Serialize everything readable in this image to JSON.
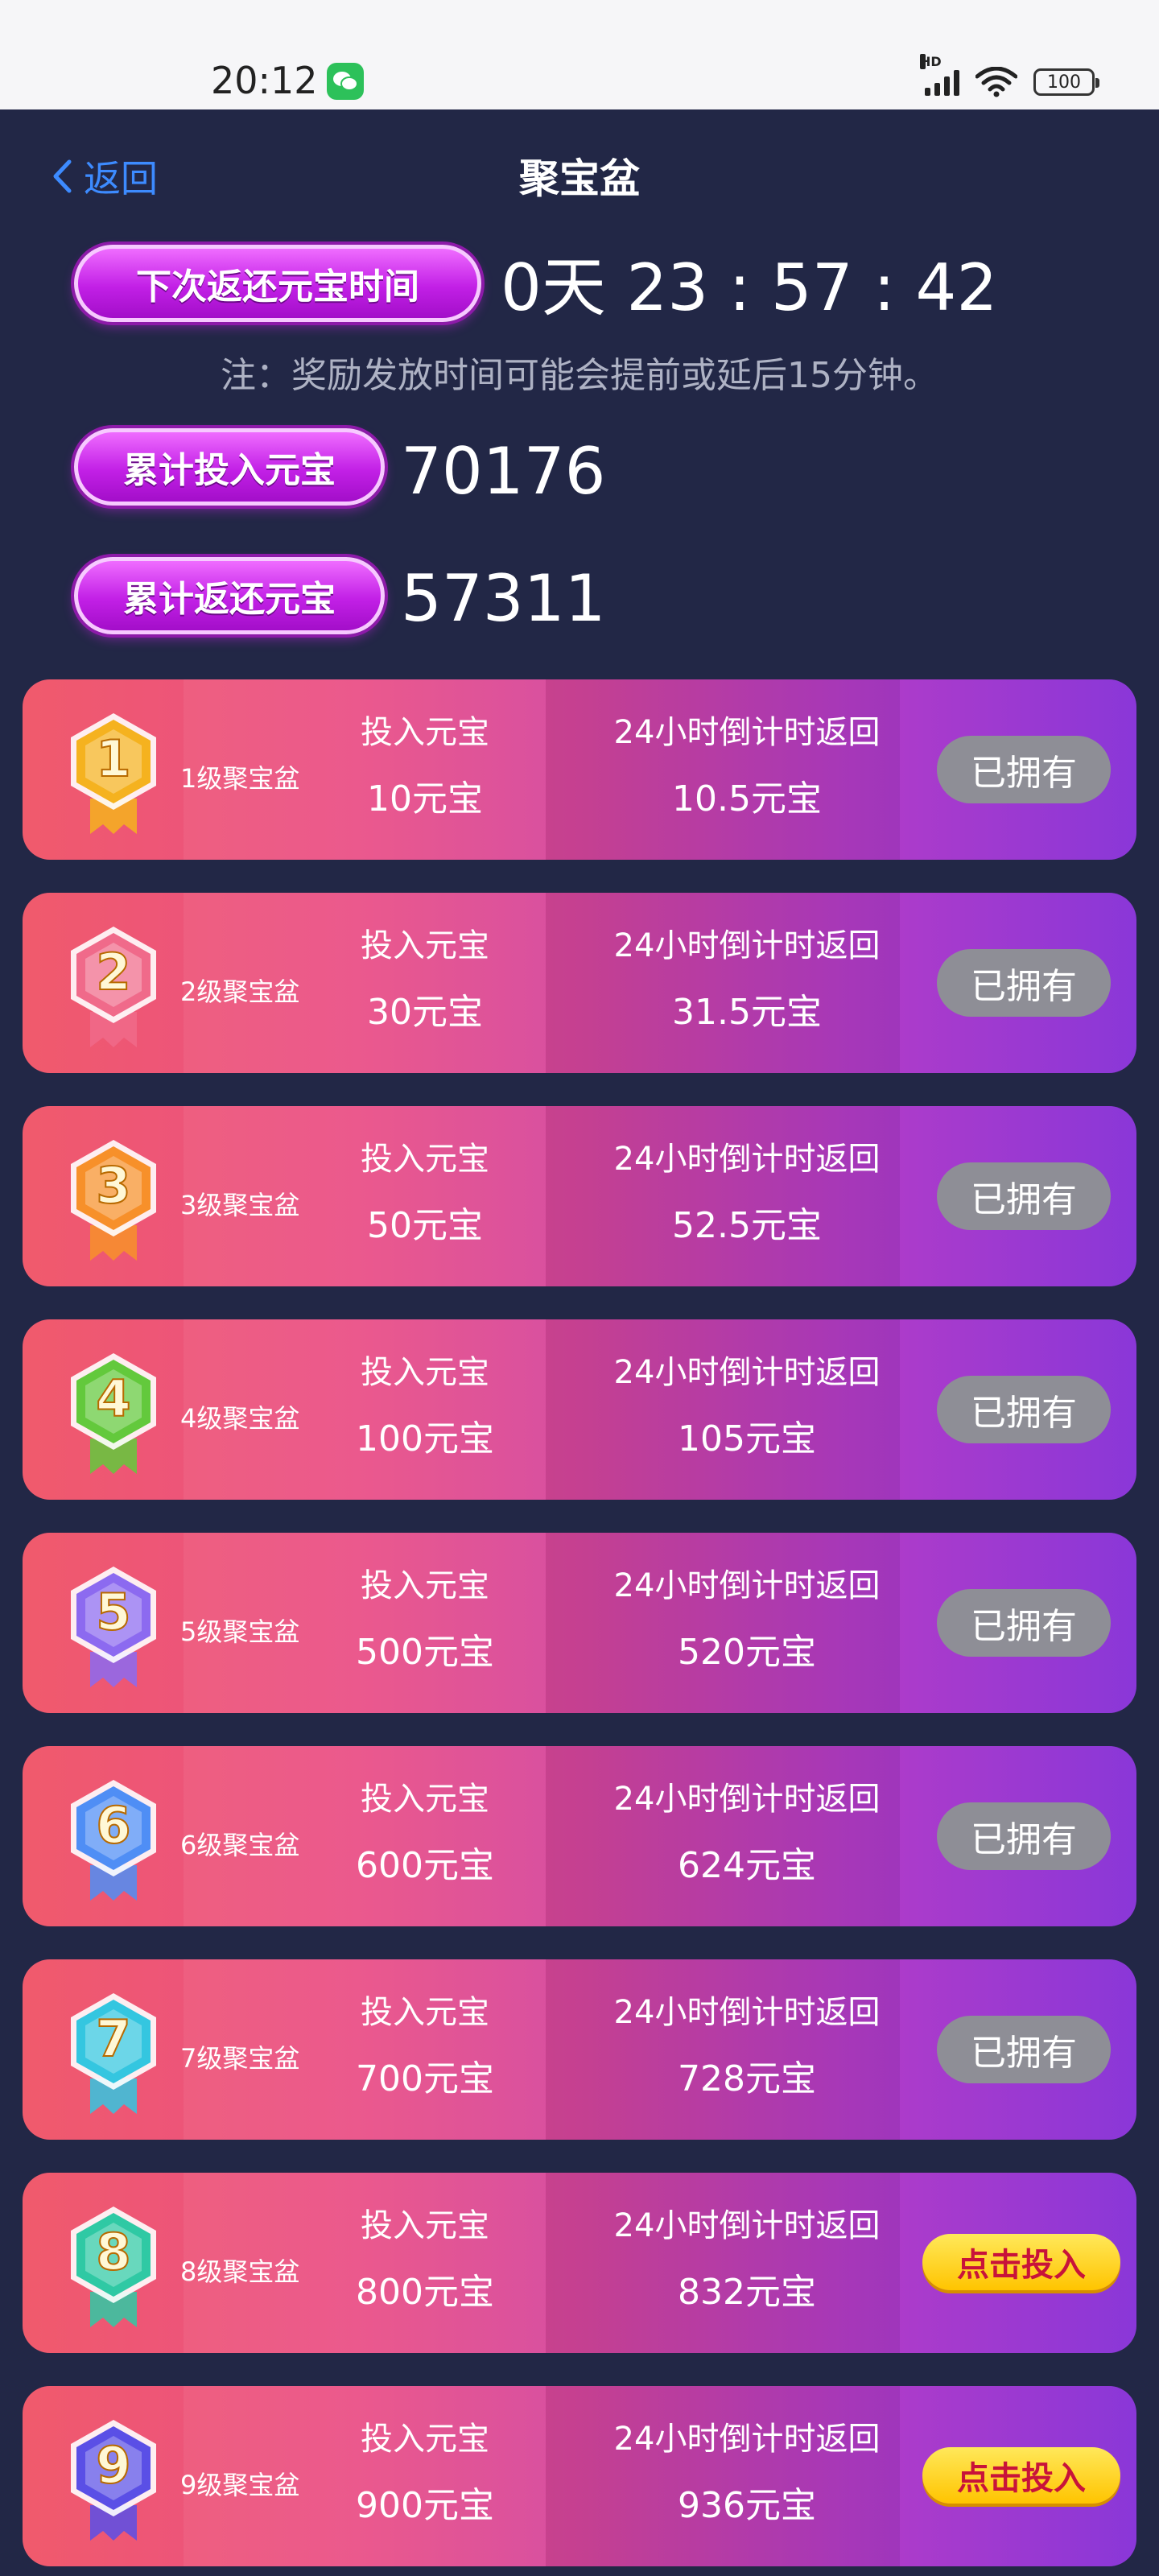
{
  "status_bar": {
    "time": "20:12",
    "network": "HD",
    "battery": "100"
  },
  "header": {
    "back_label": "返回",
    "title": "聚宝盆"
  },
  "info": {
    "next_return_label": "下次返还元宝时间",
    "countdown": "0天 23 : 57 : 42",
    "note": "注：奖励发放时间可能会提前或延后15分钟。",
    "total_invest_label": "累计投入元宝",
    "total_invest_value": "70176",
    "total_return_label": "累计返还元宝",
    "total_return_value": "57311"
  },
  "level_cards": [
    {
      "badge_number": "1",
      "badge_color": "#f5b21f",
      "level_name": "1级聚宝盆",
      "invest_header": "投入元宝",
      "invest_value": "10元宝",
      "return_header": "24小时倒计时返回",
      "return_value": "10.5元宝",
      "button": "已拥有",
      "owned": true
    },
    {
      "badge_number": "2",
      "badge_color": "#f06a8a",
      "level_name": "2级聚宝盆",
      "invest_header": "投入元宝",
      "invest_value": "30元宝",
      "return_header": "24小时倒计时返回",
      "return_value": "31.5元宝",
      "button": "已拥有",
      "owned": true
    },
    {
      "badge_number": "3",
      "badge_color": "#f7902a",
      "level_name": "3级聚宝盆",
      "invest_header": "投入元宝",
      "invest_value": "50元宝",
      "return_header": "24小时倒计时返回",
      "return_value": "52.5元宝",
      "button": "已拥有",
      "owned": true
    },
    {
      "badge_number": "4",
      "badge_color": "#63c93c",
      "level_name": "4级聚宝盆",
      "invest_header": "投入元宝",
      "invest_value": "100元宝",
      "return_header": "24小时倒计时返回",
      "return_value": "105元宝",
      "button": "已拥有",
      "owned": true
    },
    {
      "badge_number": "5",
      "badge_color": "#8c6af0",
      "level_name": "5级聚宝盆",
      "invest_header": "投入元宝",
      "invest_value": "500元宝",
      "return_header": "24小时倒计时返回",
      "return_value": "520元宝",
      "button": "已拥有",
      "owned": true
    },
    {
      "badge_number": "6",
      "badge_color": "#4f8ef5",
      "level_name": "6级聚宝盆",
      "invest_header": "投入元宝",
      "invest_value": "600元宝",
      "return_header": "24小时倒计时返回",
      "return_value": "624元宝",
      "button": "已拥有",
      "owned": true
    },
    {
      "badge_number": "7",
      "badge_color": "#34c6e0",
      "level_name": "7级聚宝盆",
      "invest_header": "投入元宝",
      "invest_value": "700元宝",
      "return_header": "24小时倒计时返回",
      "return_value": "728元宝",
      "button": "已拥有",
      "owned": true
    },
    {
      "badge_number": "8",
      "badge_color": "#2fc9a4",
      "level_name": "8级聚宝盆",
      "invest_header": "投入元宝",
      "invest_value": "800元宝",
      "return_header": "24小时倒计时返回",
      "return_value": "832元宝",
      "button": "点击投入",
      "owned": false
    },
    {
      "badge_number": "9",
      "badge_color": "#5a4fe6",
      "level_name": "9级聚宝盆",
      "invest_header": "投入元宝",
      "invest_value": "900元宝",
      "return_header": "24小时倒计时返回",
      "return_value": "936元宝",
      "button": "点击投入",
      "owned": false
    }
  ]
}
